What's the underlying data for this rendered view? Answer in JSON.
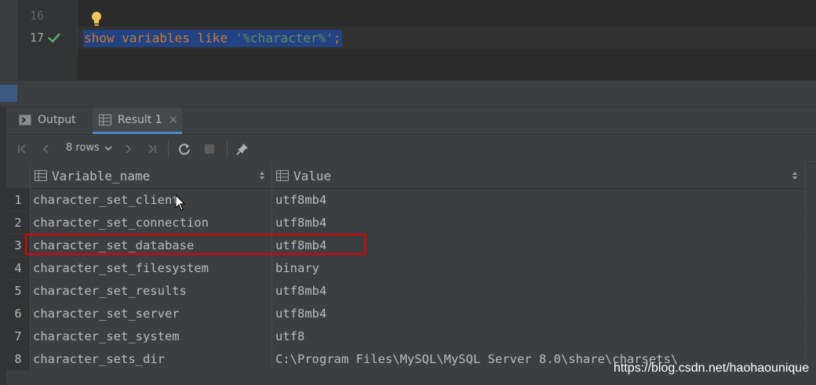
{
  "editor": {
    "lines": [
      {
        "number": "16"
      },
      {
        "number": "17"
      }
    ],
    "code": {
      "kw1": "show",
      "kw2": "variables",
      "kw3": "like",
      "str": "'%character%'",
      "semi": ";"
    }
  },
  "tabs": [
    {
      "label": "Output"
    },
    {
      "label": "Result 1"
    }
  ],
  "toolbar": {
    "rows_label": "8 rows"
  },
  "columns": [
    "Variable_name",
    "Value"
  ],
  "rows": [
    {
      "num": "1",
      "name": "character_set_client",
      "value": "utf8mb4"
    },
    {
      "num": "2",
      "name": "character_set_connection",
      "value": "utf8mb4"
    },
    {
      "num": "3",
      "name": "character_set_database",
      "value": "utf8mb4"
    },
    {
      "num": "4",
      "name": "character_set_filesystem",
      "value": "binary"
    },
    {
      "num": "5",
      "name": "character_set_results",
      "value": "utf8mb4"
    },
    {
      "num": "6",
      "name": "character_set_server",
      "value": "utf8mb4"
    },
    {
      "num": "7",
      "name": "character_set_system",
      "value": "utf8"
    },
    {
      "num": "8",
      "name": "character_sets_dir",
      "value": "C:\\Program Files\\MySQL\\MySQL Server 8.0\\share\\charsets\\"
    }
  ],
  "watermark": "https://blog.csdn.net/haohaounique",
  "colors": {
    "keyword": "#cc7832",
    "string": "#6a8759",
    "selection": "#214283",
    "highlight_box": "#e30000",
    "tab_underline": "#4a88c7"
  },
  "icons": [
    "check-icon",
    "lightbulb-icon",
    "output-icon",
    "table-icon",
    "first-page-icon",
    "prev-page-icon",
    "chevron-down-icon",
    "next-page-icon",
    "last-page-icon",
    "refresh-icon",
    "stop-icon",
    "pin-icon",
    "sort-icon",
    "close-icon"
  ]
}
